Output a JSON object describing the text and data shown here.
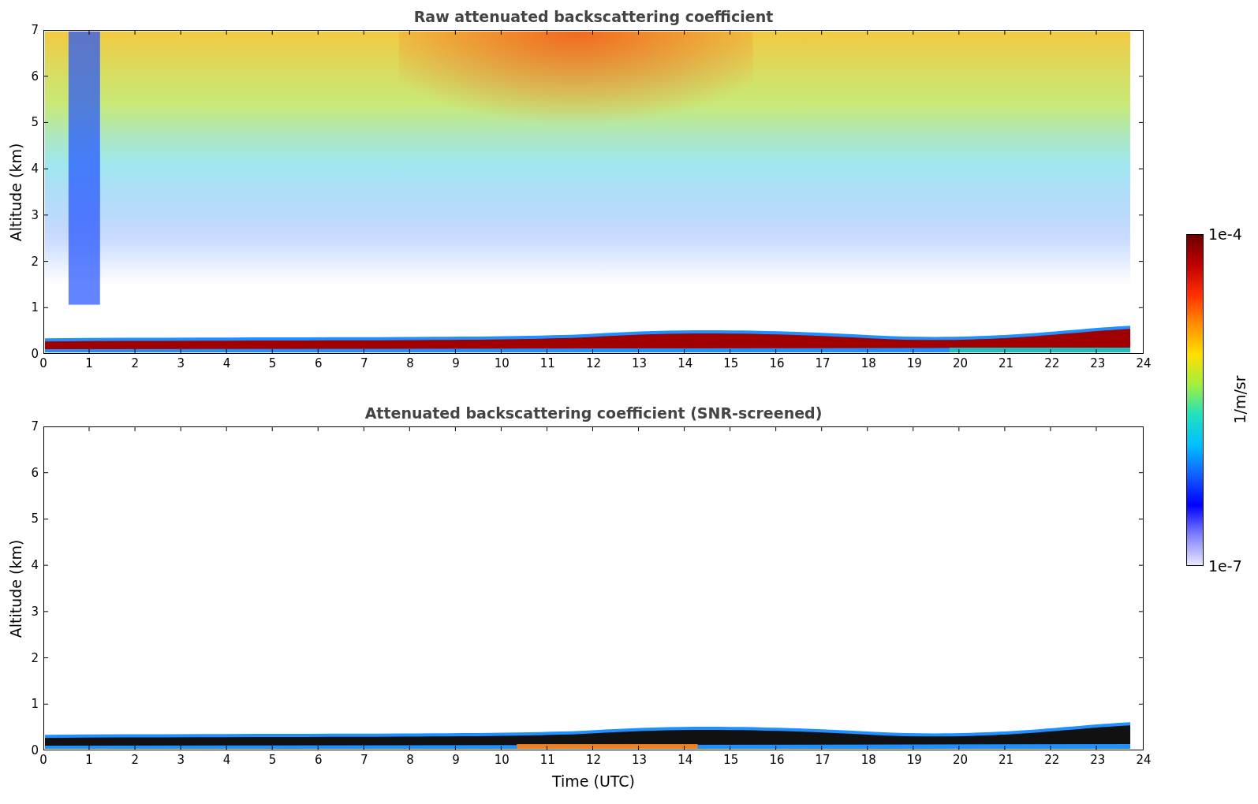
{
  "plots": [
    {
      "kind": "raw",
      "title": "Raw attenuated backscattering coefficient",
      "ylabel": "Altitude (km)",
      "yticks": [
        "7",
        "6",
        "5",
        "4",
        "3",
        "2",
        "1",
        "0"
      ],
      "xticks": [
        "0",
        "1",
        "2",
        "3",
        "4",
        "5",
        "6",
        "7",
        "8",
        "9",
        "10",
        "11",
        "12",
        "13",
        "14",
        "15",
        "16",
        "17",
        "18",
        "19",
        "20",
        "21",
        "22",
        "23",
        "24"
      ]
    },
    {
      "kind": "screened",
      "title": "Attenuated backscattering coefficient (SNR-screened)",
      "ylabel": "Altitude (km)",
      "yticks": [
        "7",
        "6",
        "5",
        "4",
        "3",
        "2",
        "1",
        "0"
      ],
      "xticks": [
        "0",
        "1",
        "2",
        "3",
        "4",
        "5",
        "6",
        "7",
        "8",
        "9",
        "10",
        "11",
        "12",
        "13",
        "14",
        "15",
        "16",
        "17",
        "18",
        "19",
        "20",
        "21",
        "22",
        "23",
        "24"
      ],
      "xlabel": "Time (UTC)"
    }
  ],
  "colorbar": {
    "max": "1e-4",
    "min": "1e-7",
    "label": "1/m/sr"
  }
}
